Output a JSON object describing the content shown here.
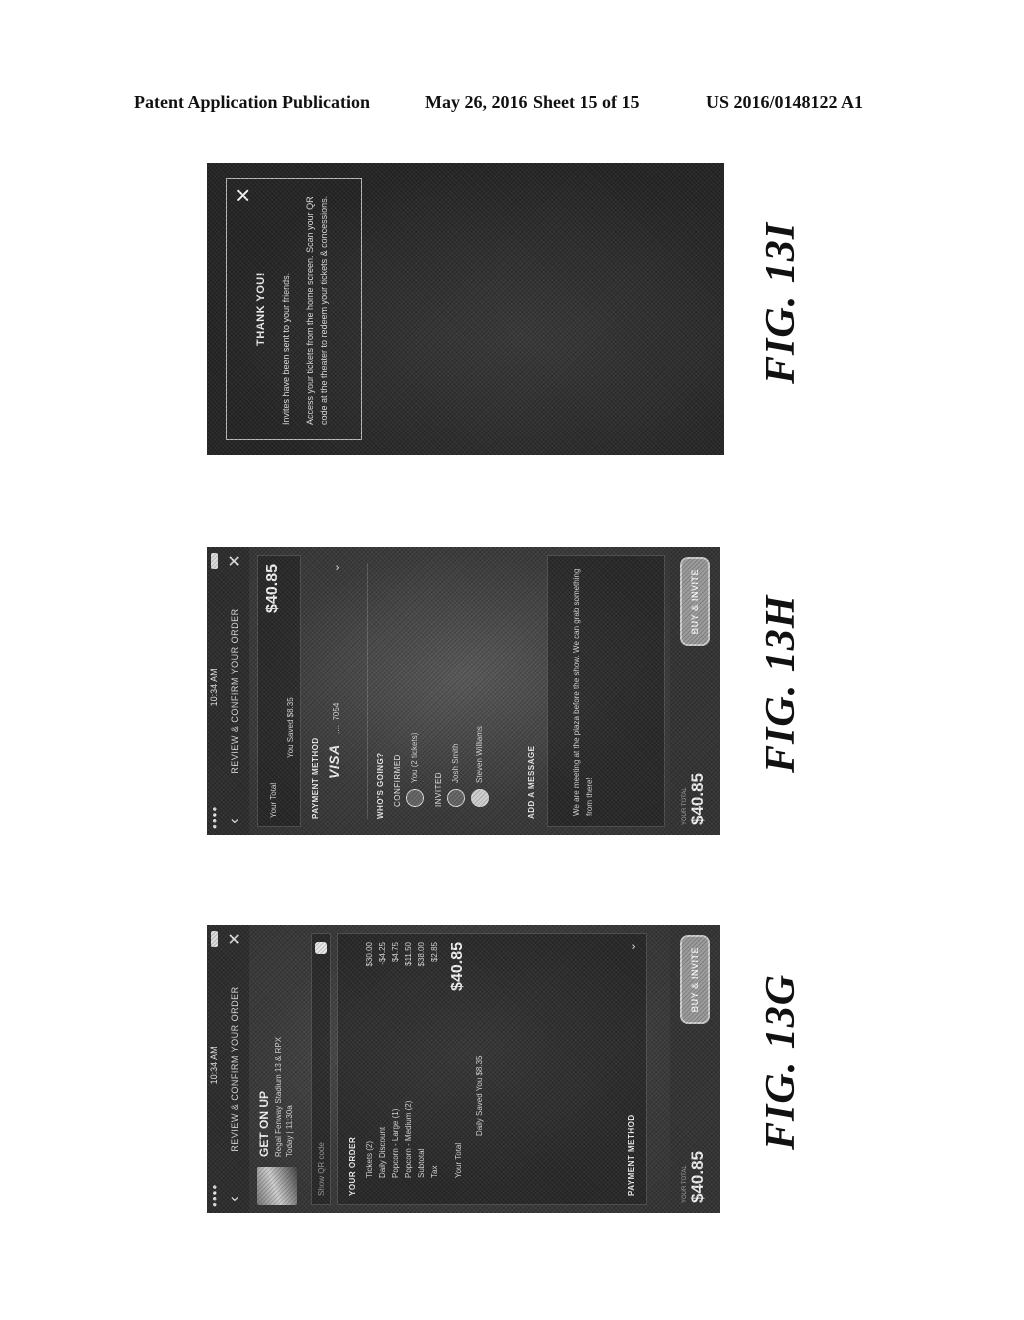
{
  "header": {
    "publication": "Patent Application Publication",
    "date": "May 26, 2016",
    "sheet": "Sheet 15 of 15",
    "number": "US 2016/0148122 A1"
  },
  "figures": {
    "fig_13i": {
      "label": "FIG. 13I",
      "modal": {
        "title": "THANK YOU!",
        "line1": "Invites have been sent to your friends.",
        "line2": "Access your tickets from the home screen. Scan your QR code at the theater to redeem your tickets & concessions.",
        "close_icon": "close-icon"
      }
    },
    "fig_13h": {
      "label": "FIG. 13H",
      "status_time": "10:34 AM",
      "title": "REVIEW & CONFIRM YOUR ORDER",
      "your_total_label": "Your Total",
      "your_total_value": "$40.85",
      "you_saved": "You Saved $8.35",
      "payment_method_label": "PAYMENT METHOD",
      "card_brand": "VISA",
      "card_last4": "7054",
      "whos_going_label": "WHO'S GOING?",
      "confirmed_label": "CONFIRMED",
      "confirmed": [
        {
          "name": "You (2 tickets)"
        }
      ],
      "invited_label": "INVITED",
      "invited": [
        {
          "name": "Josh Smith"
        },
        {
          "name": "Steven Williams"
        }
      ],
      "add_message_label": "ADD A MESSAGE",
      "message_text": "We are meeting at the plaza before the show. We can grab something from there!",
      "bottom_price_label": "YOUR TOTAL",
      "bottom_price": "$40.85",
      "buy_button": "BUY & INVITE"
    },
    "fig_13g": {
      "label": "FIG. 13G",
      "status_time": "10:34 AM",
      "title": "REVIEW & CONFIRM YOUR ORDER",
      "movie_title": "GET ON UP",
      "movie_theater": "Regal Fenway Stadium 13 & RPX",
      "movie_time": "Today | 11:30a",
      "qr_label": "Show QR code",
      "your_order_label": "YOUR ORDER",
      "order_items": [
        {
          "label": "Tickets (2)",
          "value": "$30.00"
        },
        {
          "label": "Daily Discount",
          "value": "-$4.25"
        },
        {
          "label": "Popcorn - Large (1)",
          "value": "$4.75"
        },
        {
          "label": "Popcorn - Medium (2)",
          "value": "$11.50"
        },
        {
          "label": "Subtotal",
          "value": "$38.00"
        },
        {
          "label": "Tax",
          "value": "$2.85"
        }
      ],
      "your_total_label": "Your Total",
      "your_total_value": "$40.85",
      "saved_text": "Daily Saved You $8.35",
      "payment_method_label": "PAYMENT METHOD",
      "bottom_price_label": "YOUR TOTAL",
      "bottom_price": "$40.85",
      "buy_button": "BUY & INVITE"
    }
  }
}
